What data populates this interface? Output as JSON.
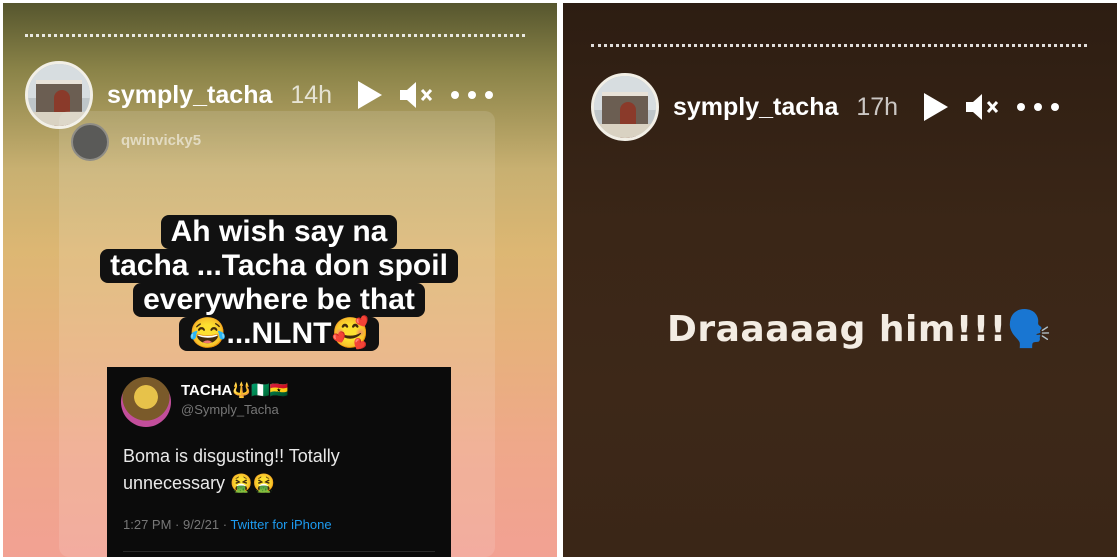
{
  "left_story": {
    "username": "symply_tacha",
    "time": "14h",
    "shared_from": "qwinvicky5",
    "caption_lines": [
      "Ah wish say na",
      "tacha ...Tacha don spoil",
      "everywhere be that",
      "😂...NLNT🥰"
    ],
    "tweet": {
      "name": "TACHA🔱🇳🇬🇬🇭",
      "handle": "@Symply_Tacha",
      "text": "Boma is disgusting!! Totally unnecessary 🤮🤮",
      "timestamp": "1:27 PM · 9/2/21 · ",
      "via": "Twitter for iPhone"
    }
  },
  "right_story": {
    "username": "symply_tacha",
    "time": "17h",
    "text": "Draaaaag him!!!🗣️"
  },
  "icons": {
    "play": "play-icon",
    "mute": "mute-icon",
    "more": "more-icon"
  },
  "colors": {
    "left_bg_top": "#56562e",
    "left_bg_bottom": "#f2a193",
    "right_bg": "#3a2617"
  }
}
